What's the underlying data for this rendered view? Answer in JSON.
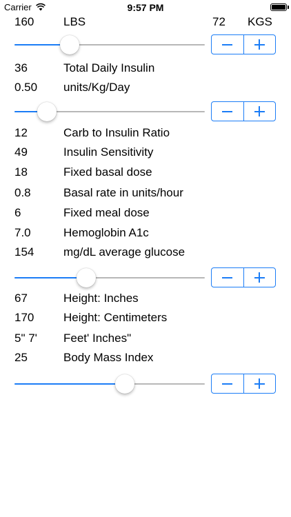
{
  "status_bar": {
    "carrier": "Carrier",
    "time": "9:57 PM",
    "wifi_icon": "wifi-icon",
    "battery_icon": "battery-icon"
  },
  "colors": {
    "accent": "#1a7cf6",
    "track": "#b7b7b7"
  },
  "weight": {
    "lbs_value": "160",
    "lbs_label": "LBS",
    "kgs_value": "72",
    "kgs_label": "KGS"
  },
  "insulin": {
    "total_daily_value": "36",
    "total_daily_label": "Total Daily Insulin",
    "per_kg_value": "0.50",
    "per_kg_label": "units/Kg/Day"
  },
  "derived": [
    {
      "value": "12",
      "label": "Carb to Insulin Ratio"
    },
    {
      "value": "49",
      "label": "Insulin Sensitivity"
    },
    {
      "value": "18",
      "label": "Fixed basal dose"
    },
    {
      "value": "0.8",
      "label": "Basal rate in units/hour"
    },
    {
      "value": "6",
      "label": "Fixed meal dose"
    }
  ],
  "glucose": {
    "a1c_value": "7.0",
    "a1c_label": "Hemoglobin A1c",
    "avg_value": "154",
    "avg_label": "mg/dL average glucose"
  },
  "height": {
    "inches_value": "67",
    "inches_label": "Height: Inches",
    "cm_value": "170",
    "cm_label": "Height: Centimeters",
    "feet_value": "5\" 7'",
    "feet_label": "Feet' Inches\"",
    "bmi_value": "25",
    "bmi_label": "Body Mass Index"
  },
  "sliders": {
    "weight_level": 0.29,
    "insulin_level": 0.17,
    "glucose_level": 0.375,
    "height_level": 0.58
  },
  "stepper_icons": {
    "minus": "minus-icon",
    "plus": "plus-icon"
  }
}
